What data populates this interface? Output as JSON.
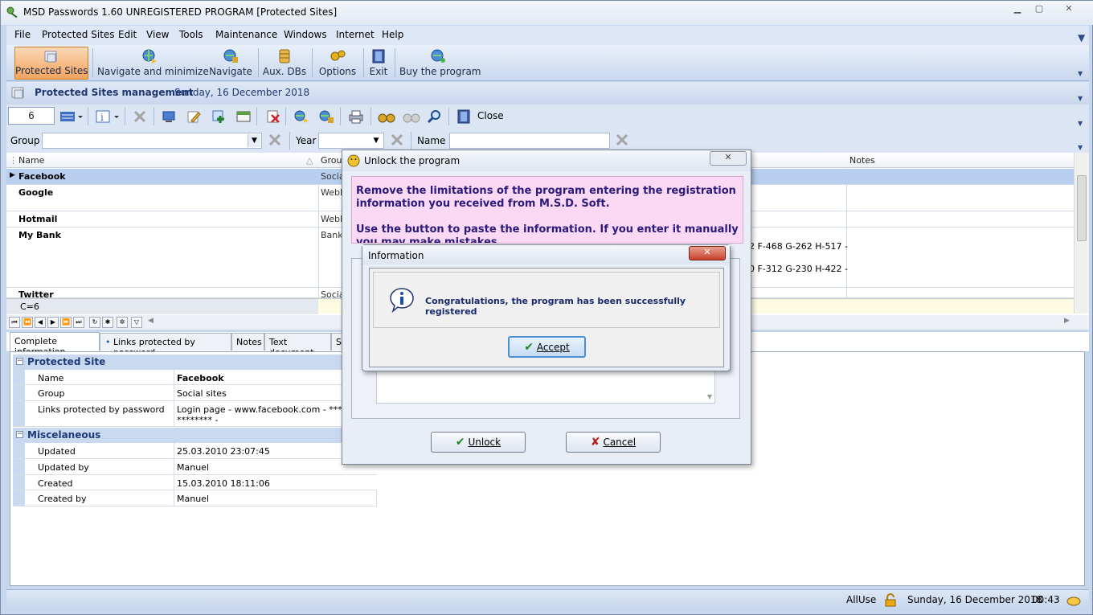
{
  "window": {
    "title": "MSD Passwords 1.60 UNREGISTERED PROGRAM [Protected Sites]"
  },
  "menu": [
    "File",
    "Protected Sites",
    "Edit",
    "View",
    "Tools",
    "Maintenance",
    "Windows",
    "Internet",
    "Help"
  ],
  "toolbar": {
    "protected_sites": "Protected Sites",
    "navigate_minimize": "Navigate and minimize",
    "navigate": "Navigate",
    "aux_dbs": "Aux. DBs",
    "options": "Options",
    "exit": "Exit",
    "buy": "Buy the program"
  },
  "header": {
    "title": "Protected Sites management",
    "date": "Sunday, 16 December 2018"
  },
  "actions": {
    "count": "6",
    "close_label": "Close"
  },
  "filters": {
    "group_label": "Group",
    "year_label": "Year",
    "name_label": "Name"
  },
  "grid": {
    "columns": {
      "name": "Name",
      "group": "Grou",
      "notes": "Notes"
    },
    "rows": [
      {
        "name": "Facebook",
        "group": "Socia"
      },
      {
        "name": "Google",
        "group": "WebM"
      },
      {
        "name": "Hotmail",
        "group": "WebM"
      },
      {
        "name": "My Bank",
        "group": "Banks"
      },
      {
        "name": "Twitter",
        "group": "Socia"
      }
    ],
    "bank_extra_1": "2 F-468 G-262 H-517 -",
    "bank_extra_2": "0 F-312 G-230 H-422 -",
    "count_label": "C=6"
  },
  "tabs": [
    "Complete information",
    "Links protected by password",
    "Notes",
    "Text document",
    "S"
  ],
  "details": {
    "cat1": "Protected Site",
    "name_k": "Name",
    "name_v": "Facebook",
    "group_k": "Group",
    "group_v": "Social sites",
    "links_k": "Links protected by password",
    "links_v1": "Login page - www.facebook.com - *********",
    "links_v2": "******** -",
    "cat2": "Miscelaneous",
    "updated_k": "Updated",
    "updated_v": "25.03.2010 23:07:45",
    "updatedby_k": "Updated by",
    "updatedby_v": "Manuel",
    "created_k": "Created",
    "created_v": "15.03.2010 18:11:06",
    "createdby_k": "Created by",
    "createdby_v": "Manuel"
  },
  "status": {
    "user": "AllUse",
    "date": "Sunday, 16 December 2018",
    "time": "00:43"
  },
  "unlock_dialog": {
    "title": "Unlock the program",
    "msg1": "Remove the limitations of the program entering the registration information you received from M.S.D. Soft.",
    "msg2": "Use the button to paste the information. If you enter it manually you may make mistakes",
    "unlock": "Unlock",
    "cancel": "Cancel"
  },
  "info_dialog": {
    "title": "Information",
    "message": "Congratulations, the program has been successfully registered",
    "accept": "Accept"
  },
  "colors": {
    "accent": "#f4a35d",
    "title_text": "#1f3770",
    "dialog_msg": "#2a1a7a",
    "dialog_bg": "#fbd9f5"
  }
}
